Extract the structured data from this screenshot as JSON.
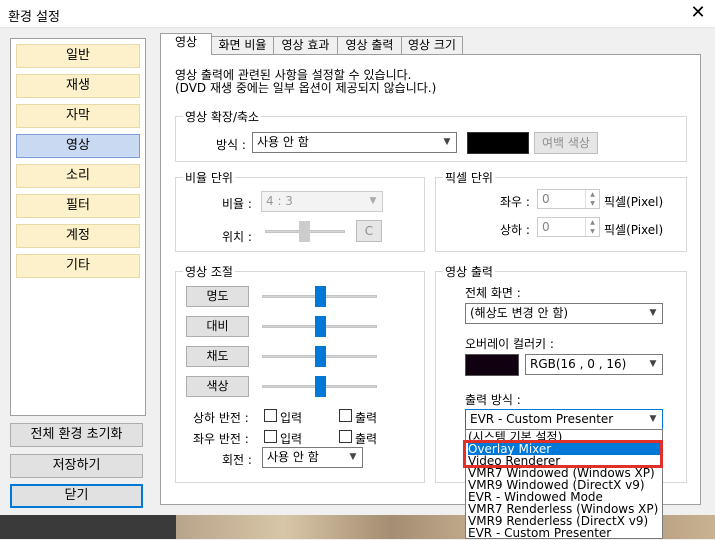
{
  "window": {
    "title": "환경 설정",
    "close_glyph": "✕"
  },
  "sidebar": {
    "items": [
      {
        "label": "일반"
      },
      {
        "label": "재생"
      },
      {
        "label": "자막"
      },
      {
        "label": "영상"
      },
      {
        "label": "소리"
      },
      {
        "label": "필터"
      },
      {
        "label": "계정"
      },
      {
        "label": "기타"
      }
    ],
    "active": "영상"
  },
  "buttons": {
    "reset_all": "전체 환경 초기화",
    "save": "저장하기",
    "close": "닫기"
  },
  "tabs": [
    {
      "label": "영상"
    },
    {
      "label": "화면 비율"
    },
    {
      "label": "영상 효과"
    },
    {
      "label": "영상 출력"
    },
    {
      "label": "영상 크기"
    }
  ],
  "description": {
    "line1": "영상 출력에 관련된 사항을 설정할 수 있습니다.",
    "line2": "(DVD 재생 중에는 일부 옵션이 제공되지 않습니다.)"
  },
  "expand": {
    "group_label": "영상 확장/축소",
    "method_label": "방식 :",
    "method_value": "사용 안 함",
    "margin_color_button": "여백 색상",
    "margin_color": "#000000"
  },
  "ratio": {
    "group_label": "비율 단위",
    "ratio_label": "비율 :",
    "ratio_value": "4 : 3",
    "position_label": "위치 :",
    "center_button": "C"
  },
  "pixel": {
    "group_label": "픽셀 단위",
    "lr_label": "좌우 :",
    "lr_value": "0",
    "lr_unit": "픽셀(Pixel)",
    "ud_label": "상하 :",
    "ud_value": "0",
    "ud_unit": "픽셀(Pixel)"
  },
  "adjust": {
    "group_label": "영상 조절",
    "sliders": [
      {
        "label": "명도",
        "level": 0.5
      },
      {
        "label": "대비",
        "level": 0.5
      },
      {
        "label": "채도",
        "level": 0.5
      },
      {
        "label": "색상",
        "level": 0.5
      }
    ],
    "vflip_label": "상하 반전 :",
    "hflip_label": "좌우 반전 :",
    "input_label": "입력",
    "output_label": "출력",
    "rotate_label": "회전 :",
    "rotate_value": "사용 안 함"
  },
  "output": {
    "group_label": "영상 출력",
    "fullscreen_label": "전체 화면 :",
    "fullscreen_value": "(해상도 변경 안 함)",
    "overlay_label": "오버레이 컬러키 :",
    "overlay_value": "RGB(16 , 0 , 16)",
    "overlay_color": "#100010",
    "method_label": "출력 방식 :",
    "method_value": "EVR - Custom Presenter",
    "options": [
      "(시스템 기본 설정)",
      "Overlay Mixer",
      "Video Renderer",
      "VMR7 Windowed (Windows XP)",
      "VMR9 Windowed (DirectX v9)",
      "EVR - Windowed Mode",
      "VMR7 Renderless (Windows XP)",
      "VMR9 Renderless (DirectX v9)",
      "EVR - Custom Presenter"
    ],
    "selected_option": "Overlay Mixer"
  },
  "colors": {
    "accent": "#0078d7",
    "highlight_box": "#e0302a",
    "sidebar_item": "#fdf1cc",
    "sidebar_active": "#c9d9f2"
  }
}
